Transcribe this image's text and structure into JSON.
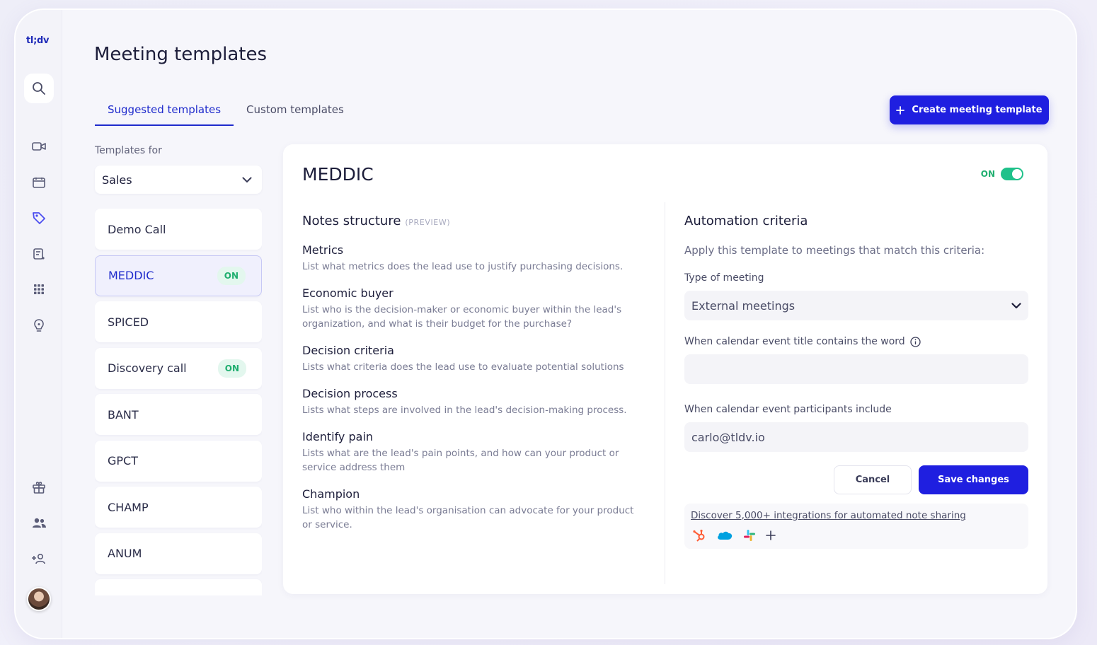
{
  "app": {
    "logo": "tl;dv"
  },
  "page": {
    "title": "Meeting templates"
  },
  "tabs": [
    {
      "label": "Suggested templates",
      "active": true
    },
    {
      "label": "Custom templates",
      "active": false
    }
  ],
  "create_button": {
    "label": "Create meeting template"
  },
  "templates_for": {
    "label": "Templates for",
    "selected": "Sales"
  },
  "templates": [
    {
      "name": "Demo Call",
      "status": ""
    },
    {
      "name": "MEDDIC",
      "status": "ON",
      "active": true
    },
    {
      "name": "SPICED",
      "status": ""
    },
    {
      "name": "Discovery call",
      "status": "ON"
    },
    {
      "name": "BANT",
      "status": ""
    },
    {
      "name": "GPCT",
      "status": ""
    },
    {
      "name": "CHAMP",
      "status": ""
    },
    {
      "name": "ANUM",
      "status": ""
    }
  ],
  "detail": {
    "title": "MEDDIC",
    "toggle_label": "ON",
    "notes_heading": "Notes structure",
    "preview_tag": "(PREVIEW)",
    "notes": [
      {
        "title": "Metrics",
        "desc": "List what metrics does the lead use to justify purchasing decisions."
      },
      {
        "title": "Economic buyer",
        "desc": "List who is the decision-maker or economic buyer within the lead's organization, and what is their budget for the purchase?"
      },
      {
        "title": "Decision criteria",
        "desc": "Lists what criteria does the lead use to evaluate potential solutions"
      },
      {
        "title": "Decision process",
        "desc": "Lists what steps are involved in the lead's decision-making process."
      },
      {
        "title": "Identify pain",
        "desc": "Lists what are the lead's pain points, and how can your product or service address them"
      },
      {
        "title": "Champion",
        "desc": "List who within the lead's organisation can advocate for your product or service."
      }
    ]
  },
  "automation": {
    "title": "Automation criteria",
    "subtitle": "Apply this template to meetings that match this criteria:",
    "type_label": "Type of meeting",
    "type_value": "External meetings",
    "title_word_label": "When calendar event title contains the word",
    "title_word_value": "",
    "participants_label": "When calendar event participants include",
    "participants_value": "carlo@tldv.io",
    "cancel_label": "Cancel",
    "save_label": "Save changes",
    "integrations_link": "Discover 5,000+ integrations for automated note sharing"
  },
  "colors": {
    "accent": "#1f1fe0",
    "on_green": "#1fae6f",
    "hubspot": "#ff5c35",
    "salesforce": "#00a1e0"
  },
  "icons": [
    "search-icon",
    "video-icon",
    "calendar-icon",
    "tag-icon",
    "notes-icon",
    "grid-icon",
    "lightbulb-icon",
    "gift-icon",
    "team-icon",
    "add-user-icon",
    "chevron-down-icon",
    "info-icon",
    "plus-icon",
    "hubspot-icon",
    "salesforce-icon",
    "slack-icon"
  ]
}
